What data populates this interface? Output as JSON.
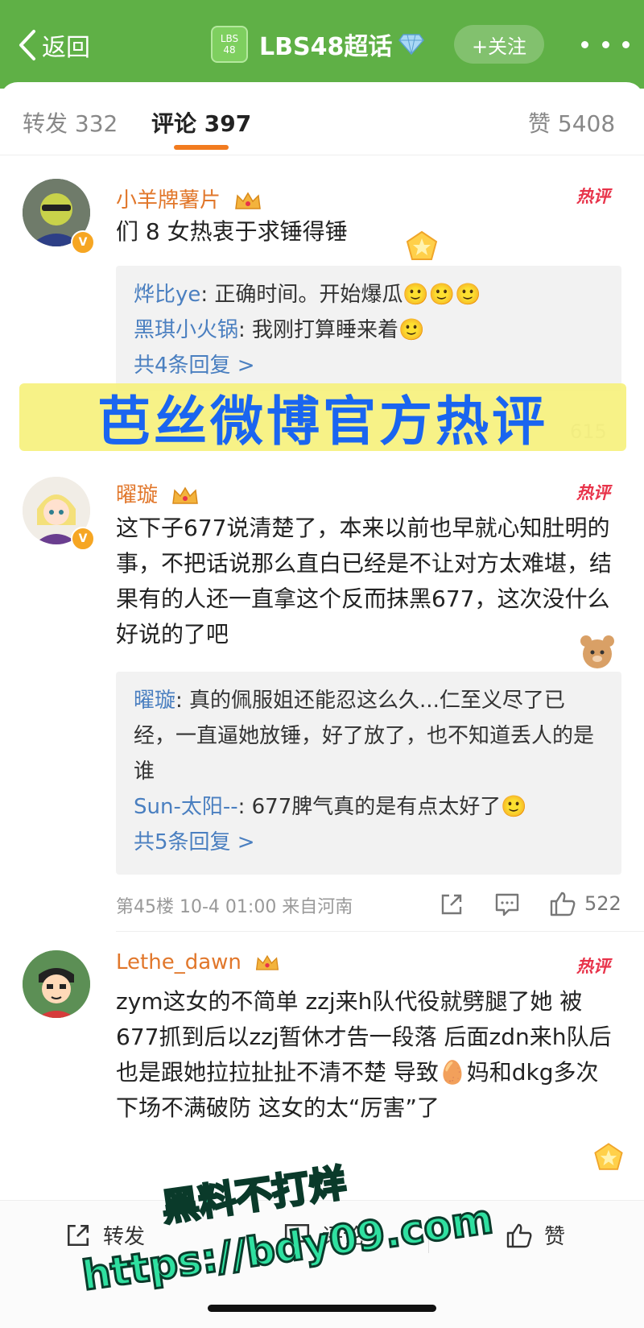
{
  "header": {
    "back_label": "返回",
    "topic_logo_line1": "LBS",
    "topic_logo_line2": "48",
    "topic_name": "LBS48超话",
    "follow_label": "+关注"
  },
  "tabs": {
    "repost": "转发 332",
    "comments": "评论 397",
    "likes": "赞 5408"
  },
  "comments": [
    {
      "user": "小羊牌薯片",
      "hot_label": "热评",
      "text": "们 8 女热衷于求锤得锤",
      "replies": [
        {
          "name": "烨比ye",
          "text": ": 正确时间。开始爆瓜🙂🙂🙂"
        },
        {
          "name": "黑琪小火锅",
          "text": ": 我刚打算睡来着🙂"
        }
      ],
      "more_replies": "共4条回复 >",
      "likes": "615"
    },
    {
      "user": "曜璇",
      "hot_label": "热评",
      "text": "这下子677说清楚了，本来以前也早就心知肚明的事，不把话说那么直白已经是不让对方太难堪，结果有的人还一直拿这个反而抹黑677，这次没什么好说的了吧",
      "replies": [
        {
          "name": "曜璇",
          "text": ": 真的佩服姐还能忍这么久...仁至义尽了已经，一直逼她放锤，好了放了，也不知道丢人的是谁"
        },
        {
          "name": "Sun-太阳--",
          "text": ": 677脾气真的是有点太好了🙂"
        }
      ],
      "more_replies": "共5条回复 >",
      "meta": "第45楼 10-4 01:00 来自河南",
      "likes": "522"
    },
    {
      "user": "Lethe_dawn",
      "hot_label": "热评",
      "text": "zym这女的不简单 zzj来h队代役就劈腿了她 被677抓到后以zzj暂休才告一段落 后面zdn来h队后也是跟她拉拉扯扯不清不楚 导致🥚妈和dkg多次下场不满破防 这女的太“厉害”了"
    }
  ],
  "overlay": {
    "banner_text": "芭丝微博官方热评"
  },
  "bottom_bar": {
    "repost": "转发",
    "comment": "评论",
    "like": "赞"
  },
  "watermark": {
    "line1": "黑料不打烊",
    "line2": "https://bdy09.com"
  }
}
